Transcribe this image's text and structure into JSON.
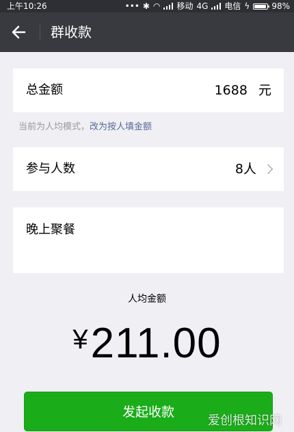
{
  "status_bar": {
    "time": "上午10:26",
    "network_4g": "4G",
    "carrier_mobile": "移动",
    "carrier_telecom": "电信",
    "battery": "98%"
  },
  "nav": {
    "title": "群收款"
  },
  "total": {
    "label": "总金额",
    "value": "1688",
    "unit": "元"
  },
  "hint": {
    "prefix": "当前为人均模式，",
    "link": "改为按人填金额"
  },
  "participants": {
    "label": "参与人数",
    "value": "8人"
  },
  "note": {
    "value": "晚上聚餐"
  },
  "per_person": {
    "label": "人均金额",
    "currency": "¥",
    "amount": "211.00"
  },
  "submit": {
    "label": "发起收款"
  },
  "watermark": "爱创根知识网",
  "colors": {
    "nav_bg": "#393a3f",
    "button_green": "#1aad19",
    "link_blue": "#576b95"
  }
}
